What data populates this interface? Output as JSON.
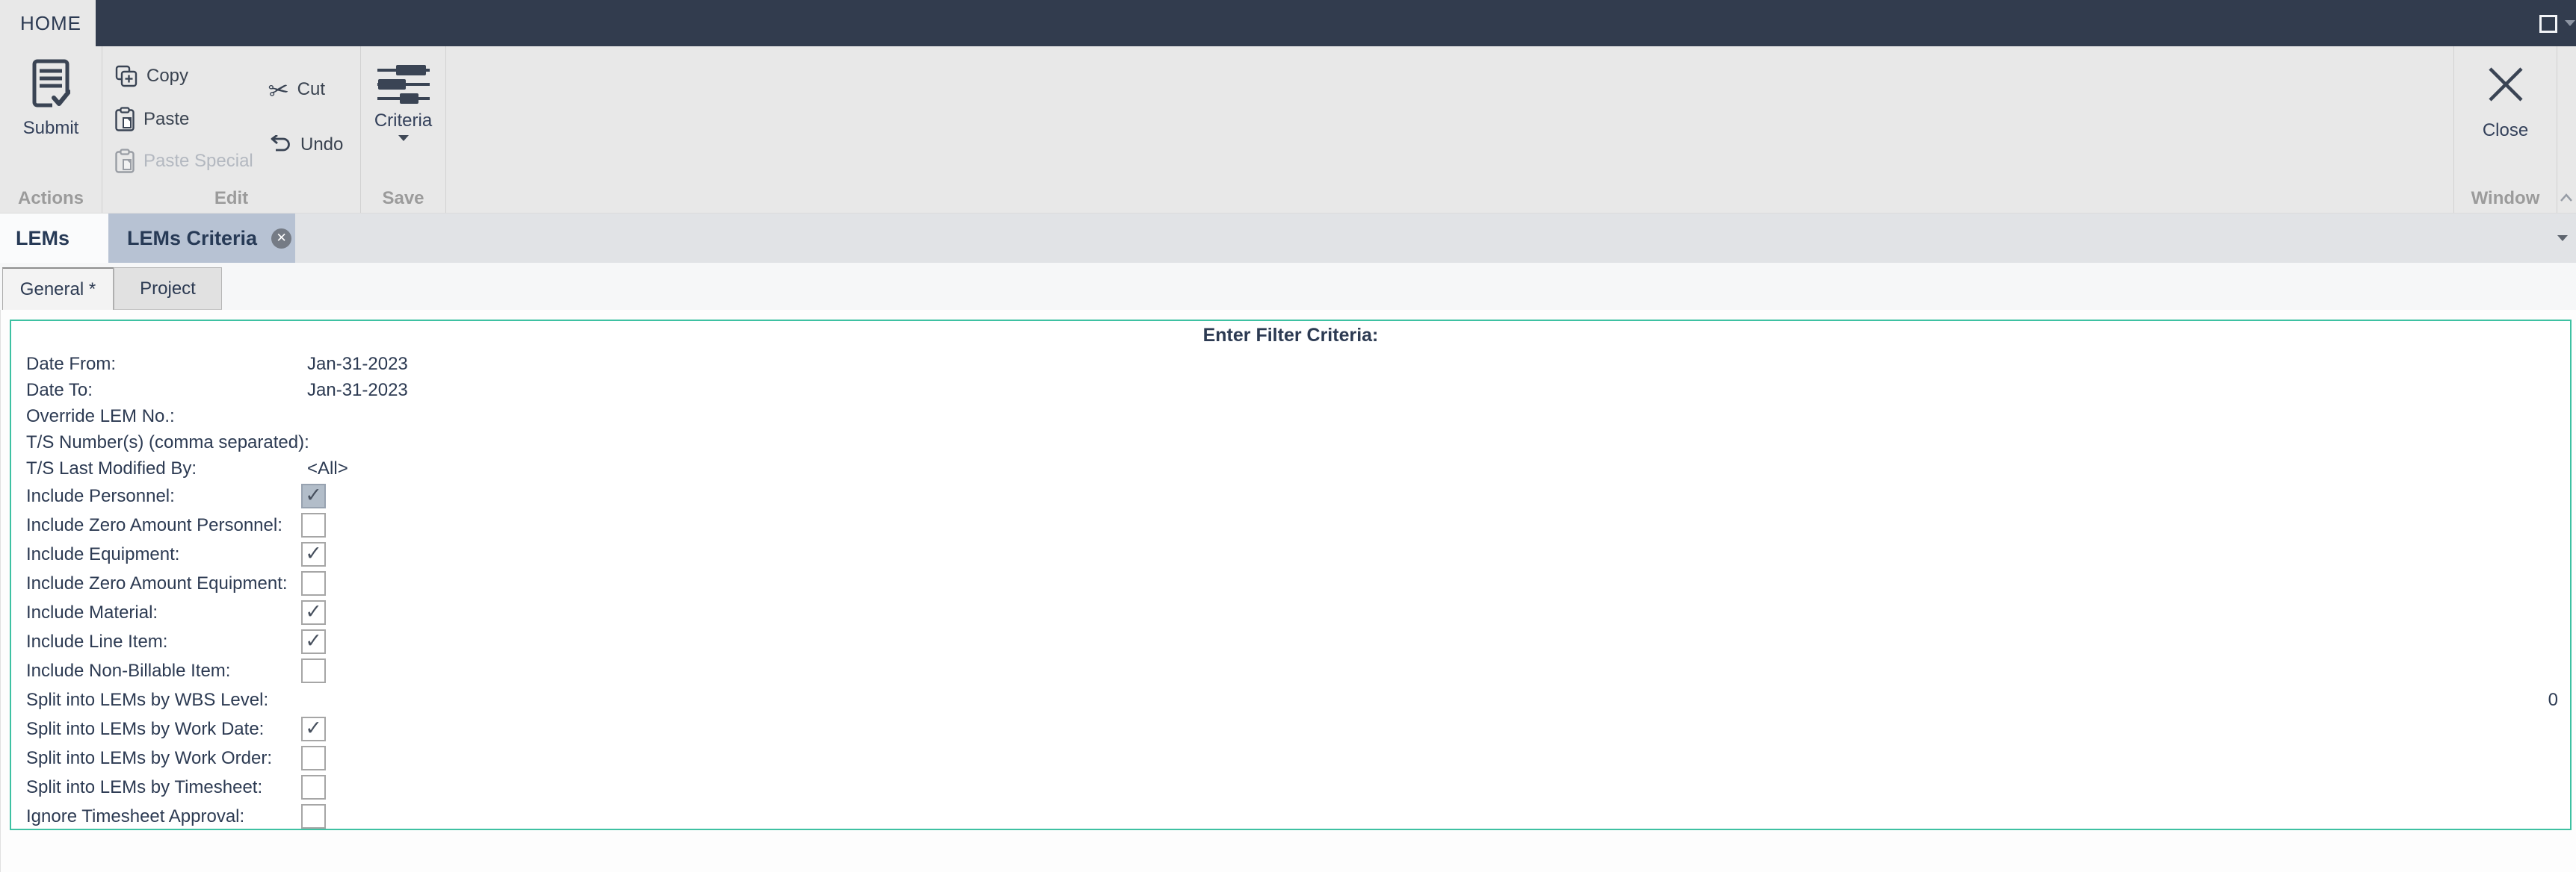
{
  "titlebar": {
    "home_tab": "HOME"
  },
  "window_controls": {
    "restore_icon": "restore-window-icon",
    "dropdown_icon": "chevron-down-icon"
  },
  "ribbon": {
    "actions": {
      "label": "Actions",
      "submit": "Submit"
    },
    "edit": {
      "label": "Edit",
      "copy": "Copy",
      "paste": "Paste",
      "paste_special": "Paste Special",
      "cut": "Cut",
      "undo": "Undo"
    },
    "save": {
      "label": "Save",
      "criteria": "Criteria"
    },
    "window": {
      "label": "Window",
      "close": "Close"
    }
  },
  "document_tabs": {
    "lems": "LEMs",
    "lems_criteria": "LEMs Criteria"
  },
  "sub_tabs": {
    "general": "General *",
    "project": "Project"
  },
  "filter_panel": {
    "title": "Enter Filter Criteria:",
    "fields": [
      {
        "label": "Date From:",
        "type": "text",
        "value": "Jan-31-2023"
      },
      {
        "label": "Date To:",
        "type": "text",
        "value": "Jan-31-2023"
      },
      {
        "label": "Override LEM No.:",
        "type": "text",
        "value": ""
      },
      {
        "label": "T/S Number(s) (comma separated):",
        "type": "text",
        "value": ""
      },
      {
        "label": "T/S Last Modified By:",
        "type": "text",
        "value": "<All>"
      },
      {
        "label": "Include Personnel:",
        "type": "checkbox",
        "checked": true,
        "focused": true
      },
      {
        "label": "Include Zero Amount Personnel:",
        "type": "checkbox",
        "checked": false
      },
      {
        "label": "Include Equipment:",
        "type": "checkbox",
        "checked": true
      },
      {
        "label": "Include Zero Amount Equipment:",
        "type": "checkbox",
        "checked": false
      },
      {
        "label": "Include Material:",
        "type": "checkbox",
        "checked": true
      },
      {
        "label": "Include Line Item:",
        "type": "checkbox",
        "checked": true
      },
      {
        "label": "Include Non-Billable Item:",
        "type": "checkbox",
        "checked": false
      },
      {
        "label": "Split into LEMs by WBS Level:",
        "type": "number",
        "value": "0"
      },
      {
        "label": "Split into LEMs by Work Date:",
        "type": "checkbox",
        "checked": true
      },
      {
        "label": "Split into LEMs by Work Order:",
        "type": "checkbox",
        "checked": false
      },
      {
        "label": "Split into LEMs by Timesheet:",
        "type": "checkbox",
        "checked": false
      },
      {
        "label": "Ignore Timesheet Approval:",
        "type": "checkbox",
        "checked": false
      }
    ]
  },
  "colors": {
    "titlebar": "#323c4e",
    "ribbon_bg": "#e8e8e8",
    "selected_doc_tab": "#b7c2d3",
    "accent_teal": "#3ec1a2",
    "text_navy": "#2c3a52",
    "icon_slate": "#3a4454",
    "focused_checkbox": "#b2bdc9"
  }
}
